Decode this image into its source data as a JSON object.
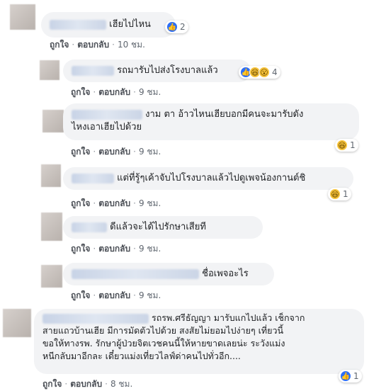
{
  "labels": {
    "like": "ถูกใจ",
    "reply": "ตอบกลับ",
    "dot": "·"
  },
  "comments": [
    {
      "text": "เฮียไปไหน",
      "time": "10 ชม.",
      "react_count": "2",
      "reactions": [
        "like"
      ]
    },
    {
      "text": "รถมารับไปส่งโรงบาลแล้ว",
      "time": "9 ชม.",
      "react_count": "4",
      "reactions": [
        "like",
        "haha",
        "wow"
      ]
    },
    {
      "text_line1": "งาม ตา อ้าวไหนเฮียบอกมีคนจะมารับดัง",
      "text_line2": "ไหงเอาเฮียไปด้วย",
      "time": "9 ชม.",
      "react_count": "1",
      "reactions": [
        "haha"
      ]
    },
    {
      "text": "แต่ที่รู้ๆเค้าจับไปโรงบาลแล้วไปดูเพจน้องกานต์ชิ",
      "time": "9 ชม.",
      "react_count": "1",
      "reactions": [
        "haha"
      ]
    },
    {
      "text": "ดีแล้วจะได้ไปรักษาเสียที",
      "time": "9 ชม."
    },
    {
      "text": "ชื่อเพจอะไร",
      "time": "9 ชม."
    },
    {
      "text_line1": "รถรพ.ศรีธัญญา มารับแกไปแล้ว เช็กจาก",
      "text_line2": "สายแถวบ้านเฮีย มีการมัดตัวไปด้วย สงสัยไม่ยอมไปง่ายๆ เที่ยวนี้",
      "text_line3": "ขอให้ทางรพ. รักษาผู้ป่วยจิตเวชคนนี้ให้หายขาดเลยน่ะ ระวังแม่ง",
      "text_line4": "หนีกลับมาอีกละ เดี๋ยวแม่งเที่ยวไลฟ์ด่าคนไปทั่วอีก....",
      "time": "8 ชม.",
      "react_count": "1",
      "reactions": [
        "like"
      ]
    }
  ],
  "reaction_icons": {
    "like": "👍",
    "haha": "😆",
    "wow": "😮"
  },
  "colors": {
    "bubble": "#f2f3f5",
    "link": "#4b4f56",
    "like_blue": "#2d6ff7",
    "emoji_yellow": "#f7c33a"
  }
}
